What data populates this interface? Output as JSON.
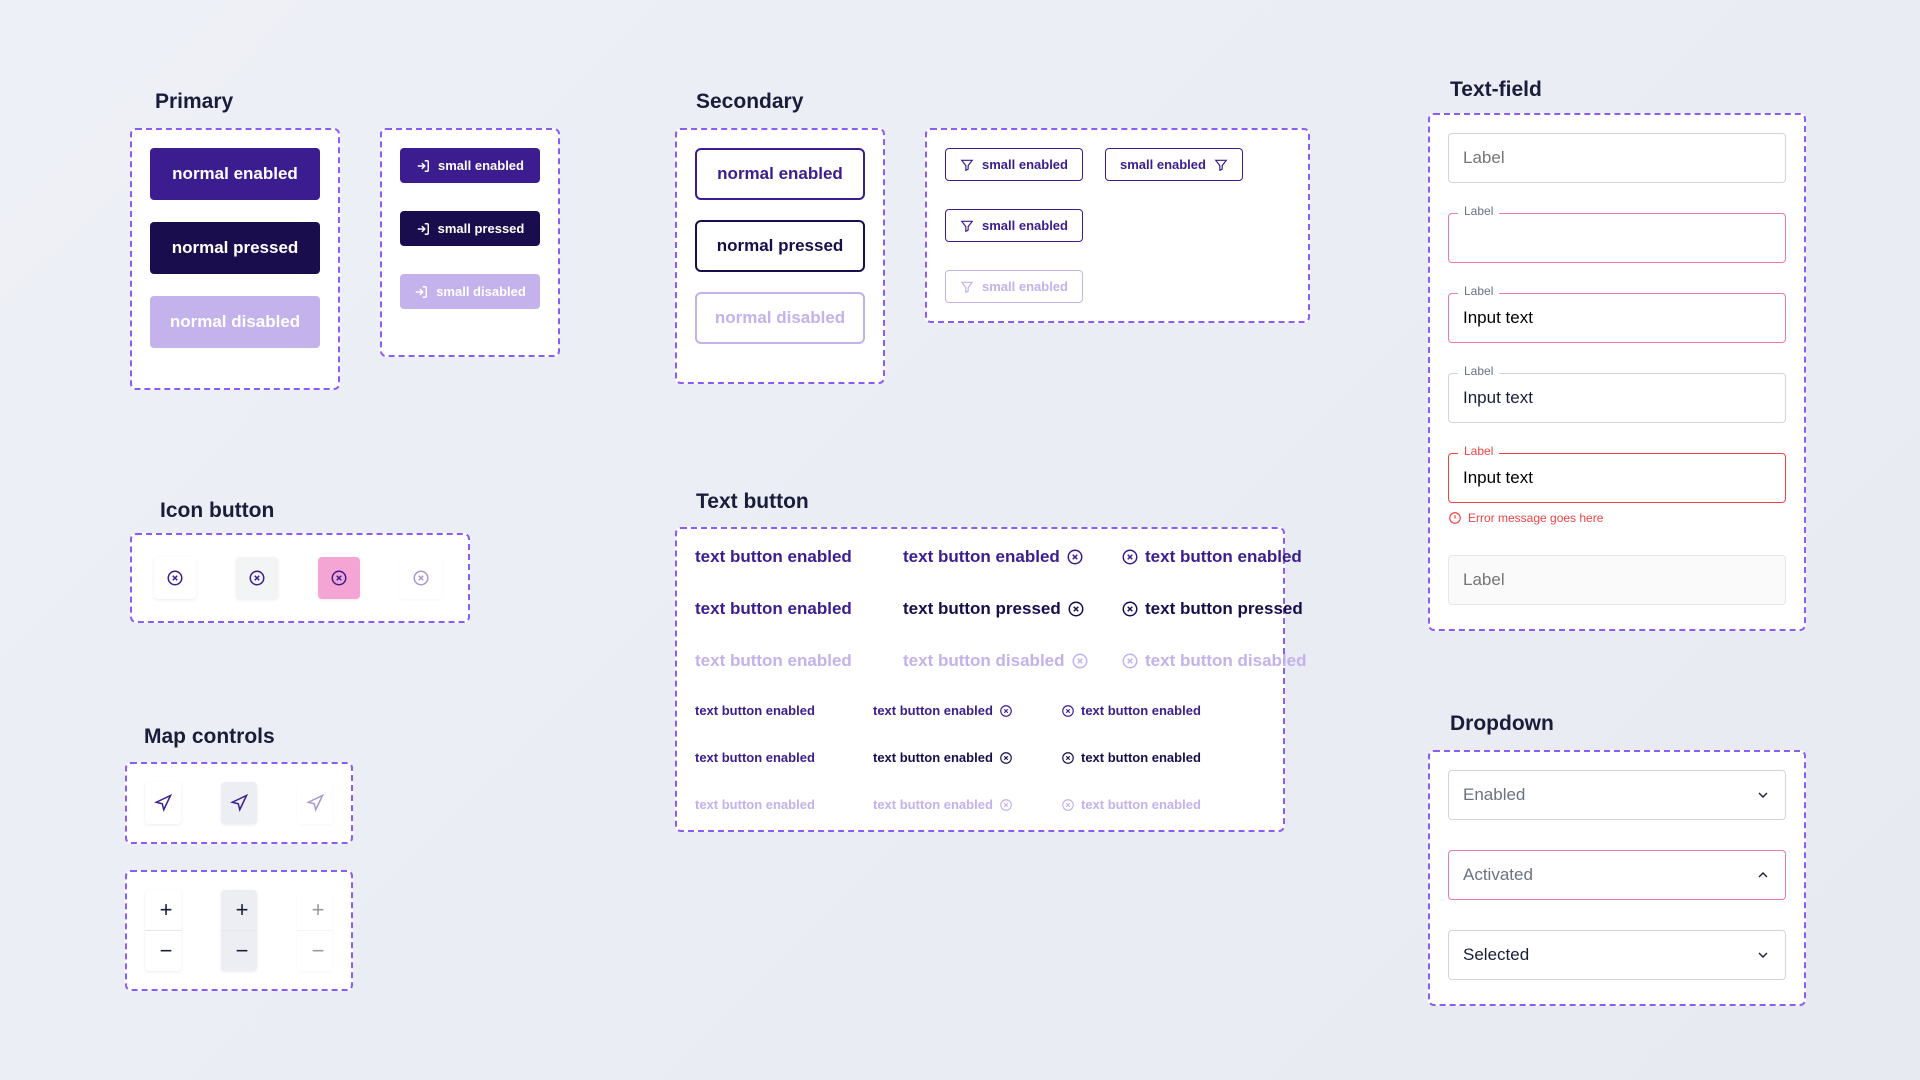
{
  "primary": {
    "title": "Primary",
    "normal": {
      "enabled": "normal enabled",
      "pressed": "normal pressed",
      "disabled": "normal disabled"
    },
    "small": {
      "enabled": "small enabled",
      "pressed": "small pressed",
      "disabled": "small disabled"
    }
  },
  "secondary": {
    "title": "Secondary",
    "normal": {
      "enabled": "normal enabled",
      "pressed": "normal pressed",
      "disabled": "normal disabled"
    },
    "small": {
      "enabled1": "small enabled",
      "enabled2": "small enabled",
      "enabled3": "small enabled",
      "disabled": "small enabled"
    }
  },
  "iconButton": {
    "title": "Icon button"
  },
  "mapControls": {
    "title": "Map controls",
    "plus": "+",
    "minus": "−"
  },
  "textButton": {
    "title": "Text button",
    "lg": {
      "r1c1": "text button enabled",
      "r1c2": "text button enabled",
      "r1c3": "text button enabled",
      "r2c1": "text button enabled",
      "r2c2": "text button pressed",
      "r2c3": "text button pressed",
      "r3c1": "text button enabled",
      "r3c2": "text button disabled",
      "r3c3": "text button disabled"
    },
    "sm": {
      "r1c1": "text button enabled",
      "r1c2": "text button enabled",
      "r1c3": "text button enabled",
      "r2c1": "text button enabled",
      "r2c2": "text button enabled",
      "r2c3": "text button enabled",
      "r3c1": "text button enabled",
      "r3c2": "text button enabled",
      "r3c3": "text button enabled"
    }
  },
  "textField": {
    "title": "Text-field",
    "placeholder": "Label",
    "floatLabel": "Label",
    "inputText": "Input text",
    "errorMsg": "Error message goes here"
  },
  "dropdown": {
    "title": "Dropdown",
    "enabled": "Enabled",
    "activated": "Activated",
    "selected": "Selected"
  }
}
